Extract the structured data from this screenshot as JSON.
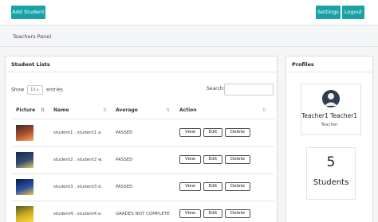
{
  "topbar": {
    "add_label": "Add Student",
    "settings_label": "Settings",
    "logout_label": "Logout"
  },
  "page": {
    "title": "Teachers Panel"
  },
  "students_card": {
    "title": "Student Lists",
    "show_label": "Show",
    "show_value": "10",
    "entries_label": "entries",
    "search_label": "Search:",
    "search_value": ""
  },
  "table": {
    "columns": [
      "Picture",
      "Name",
      "Average",
      "Action"
    ],
    "actions": {
      "view": "View",
      "edit": "Edit",
      "delete": "Delete"
    },
    "rows": [
      {
        "name": "student1 . student1 a.",
        "average": "PASSED",
        "thumb_colors": [
          "#3b2a2a",
          "#b3502c",
          "#f0a860"
        ]
      },
      {
        "name": "student2 . student2 w.",
        "average": "PASSED",
        "thumb_colors": [
          "#1b2a44",
          "#324c78",
          "#e7c85a"
        ]
      },
      {
        "name": "student3 . student3 d.",
        "average": "PASSED",
        "thumb_colors": [
          "#0b1a4a",
          "#2a52a8",
          "#f3c341"
        ]
      },
      {
        "name": "student4 . student4 e.",
        "average": "GRADES NOT COMPLETE",
        "thumb_colors": [
          "#4a5a22",
          "#d6b023",
          "#f5d84a"
        ]
      }
    ]
  },
  "profile": {
    "title": "Profiles",
    "name": "Teacher1 Teacher1",
    "role": "Teacher",
    "student_count": "5",
    "student_label": "Students"
  },
  "colors": {
    "accent": "#17a2a6"
  }
}
